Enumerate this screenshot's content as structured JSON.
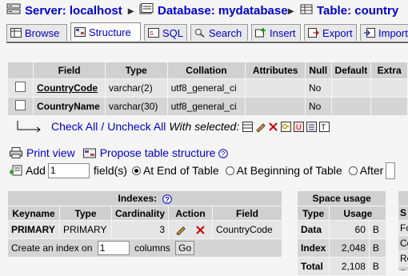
{
  "breadcrumb": {
    "server": "Server: localhost",
    "database": "Database: mydatabase",
    "table": "Table: country"
  },
  "tabs": [
    {
      "label": "Browse",
      "icon": "browse-icon",
      "active": false
    },
    {
      "label": "Structure",
      "icon": "structure-icon",
      "active": true
    },
    {
      "label": "SQL",
      "icon": "sql-icon",
      "active": false
    },
    {
      "label": "Search",
      "icon": "search-icon",
      "active": false
    },
    {
      "label": "Insert",
      "icon": "insert-icon",
      "active": false
    },
    {
      "label": "Export",
      "icon": "export-icon",
      "active": false
    },
    {
      "label": "Import",
      "icon": "import-icon",
      "active": false
    }
  ],
  "structure": {
    "columns": [
      "Field",
      "Type",
      "Collation",
      "Attributes",
      "Null",
      "Default",
      "Extra"
    ],
    "rows": [
      {
        "field": "CountryCode",
        "type": "varchar(2)",
        "collation": "utf8_general_ci",
        "attributes": "",
        "null": "No",
        "default": "",
        "extra": ""
      },
      {
        "field": "CountryName",
        "type": "varchar(30)",
        "collation": "utf8_general_ci",
        "attributes": "",
        "null": "No",
        "default": "",
        "extra": ""
      }
    ],
    "check_all": "Check All",
    "separator": "/",
    "uncheck_all": "Uncheck All",
    "with_selected": "With selected:"
  },
  "actions": {
    "print_view": "Print view",
    "propose": "Propose table structure"
  },
  "add_field": {
    "add_label": "Add",
    "count": "1",
    "fields_label": "field(s)",
    "opt_end": "At End of Table",
    "opt_begin": "At Beginning of Table",
    "opt_after": "After"
  },
  "indexes": {
    "title": "Indexes:",
    "columns": [
      "Keyname",
      "Type",
      "Cardinality",
      "Action",
      "Field"
    ],
    "rows": [
      {
        "keyname": "PRIMARY",
        "type": "PRIMARY",
        "cardinality": "3",
        "field": "CountryCode"
      }
    ],
    "create_label": "Create an index on",
    "create_count": "1",
    "columns_label": "columns",
    "go": "Go"
  },
  "space": {
    "title": "Space usage",
    "columns": [
      "Type",
      "Usage"
    ],
    "rows": [
      {
        "type": "Data",
        "value": "60",
        "unit": "B"
      },
      {
        "type": "Index",
        "value": "2,048",
        "unit": "B"
      },
      {
        "type": "Total",
        "value": "2,108",
        "unit": "B"
      }
    ]
  },
  "stats_partial": {
    "header": "S",
    "rows": [
      "Fo",
      "Co",
      "Ro",
      "Ro"
    ]
  },
  "colors": {
    "link": "#0000cc",
    "header_bg": "#d0d0d0",
    "row1": "#e5e5e5",
    "row2": "#d5d5d5",
    "delete": "#cc0000"
  }
}
